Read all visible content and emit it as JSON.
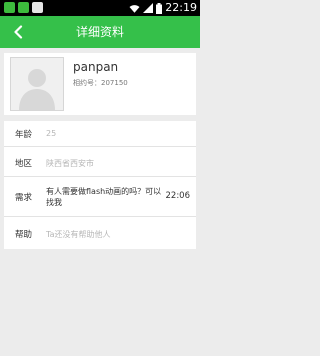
{
  "status_bar": {
    "time": "22:19",
    "icons": [
      "notification-green-icon",
      "notification-android-icon",
      "notification-white-icon",
      "wifi-icon",
      "cell-signal-icon",
      "battery-icon"
    ]
  },
  "header": {
    "title": "详细资料",
    "back_icon": "chevron-left-icon"
  },
  "profile": {
    "username": "panpan",
    "user_id": "相约号：207150"
  },
  "info": {
    "age": {
      "label": "年龄",
      "value": "25"
    },
    "region": {
      "label": "地区",
      "value": "陕西省西安市"
    },
    "request": {
      "label": "需求",
      "value": "有人需要做flash动画的吗？可以找我",
      "time": "22:06"
    },
    "help": {
      "label": "帮助",
      "value": "Ta还没有帮助他人"
    }
  },
  "colors": {
    "accent": "#35c04a",
    "background": "#ececec",
    "placeholder_text": "#b6b6b6"
  }
}
